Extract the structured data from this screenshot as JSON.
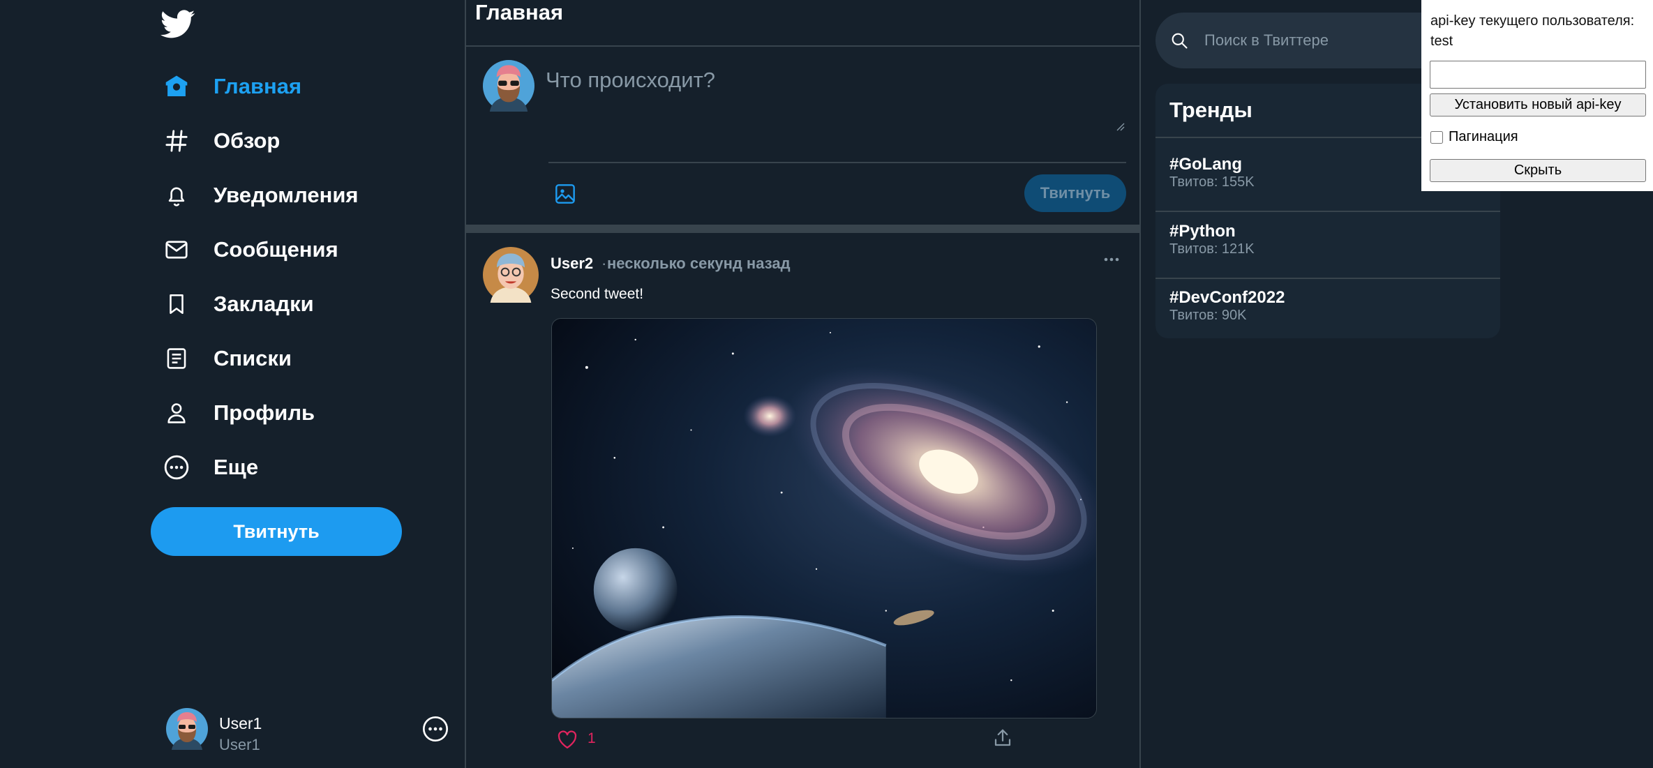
{
  "sidebar": {
    "logo_icon": "twitter-bird-icon",
    "items": [
      {
        "label": "Главная",
        "icon": "home-icon",
        "active": true
      },
      {
        "label": "Обзор",
        "icon": "hashtag-icon"
      },
      {
        "label": "Уведомления",
        "icon": "bell-icon"
      },
      {
        "label": "Сообщения",
        "icon": "mail-icon"
      },
      {
        "label": "Закладки",
        "icon": "bookmark-icon"
      },
      {
        "label": "Списки",
        "icon": "list-icon"
      },
      {
        "label": "Профиль",
        "icon": "person-icon"
      },
      {
        "label": "Еще",
        "icon": "more-circle-icon"
      }
    ],
    "tweet_button": "Твитнуть",
    "account": {
      "name": "User1",
      "handle": "User1"
    }
  },
  "main": {
    "title": "Главная",
    "composer": {
      "placeholder": "Что происходит?",
      "tweet_button": "Твитнуть"
    },
    "tweet": {
      "user": "User2",
      "separator": "·",
      "time": "несколько секунд назад",
      "text": "Second tweet!",
      "likes": "1"
    }
  },
  "right": {
    "search_placeholder": "Поиск в Твиттере",
    "trends_title": "Тренды",
    "trends": [
      {
        "tag": "#GoLang",
        "count": "Твитов: 155K"
      },
      {
        "tag": "#Python",
        "count": "Твитов: 121K"
      },
      {
        "tag": "#DevConf2022",
        "count": "Твитов: 90K"
      }
    ]
  },
  "api_panel": {
    "label": "api-key текущего пользователя: test",
    "set_button": "Установить новый api-key",
    "pagination_label": "Пагинация",
    "hide_button": "Скрыть"
  },
  "colors": {
    "background": "#15202b",
    "accent": "#1d9bf0",
    "border": "#38444d",
    "muted_text": "#8899a6",
    "like": "#e0245e"
  }
}
